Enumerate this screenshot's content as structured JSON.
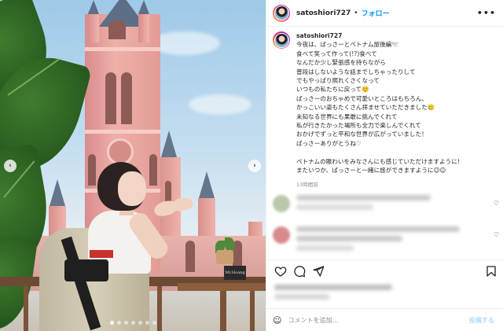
{
  "post": {
    "username": "satoshiori727",
    "separator": "•",
    "follow_label": "フォロー",
    "more_icon": "more-horizontal-icon",
    "caption_user": "satoshiori727",
    "caption_lines_1": [
      "今夜は、ばっさーとベトナム旅後編🕊️",
      "食べて笑って作って(!?)食べて",
      "なんだか少し緊張感を持ちながら",
      "普段はしないような話までしちゃったりして",
      "でもやっぱり照れくさくなって",
      "いつもの私たちに戻って☺️",
      "ばっさーのおちゃめで可愛いところはもちろん、",
      "かっこいい姿もたくさん拝ませていただきました🥲",
      "未知なる世界にも果敢に挑んでくれて",
      "私が行きたかった場所も全力で楽しんでくれて",
      "おかげでずっと平和な世界が広がっていました！",
      "ばっさーありがとうね♡"
    ],
    "caption_lines_2": [
      "ベトナムの賑わいをみなさんにも感じていただけますように！",
      "またいつか、ばっさーと一緒に旅ができますように☺︎☺︎"
    ],
    "time_ago": "13時間前",
    "add_comment_placeholder": "コメントを追加...",
    "post_button": "投稿する",
    "photo_sign_text": "Mr.Hoang"
  },
  "carousel": {
    "slide_count": 7,
    "active_index": 0
  },
  "icons": {
    "prev": "chevron-left-icon",
    "next": "chevron-right-icon",
    "like": "heart-icon",
    "comment": "comment-icon",
    "share": "send-icon",
    "save": "bookmark-icon",
    "emoji": "emoji-icon"
  },
  "colors": {
    "follow": "#0095f6",
    "muted": "#8e8e8e",
    "post_button_disabled": "#b3dbff"
  }
}
